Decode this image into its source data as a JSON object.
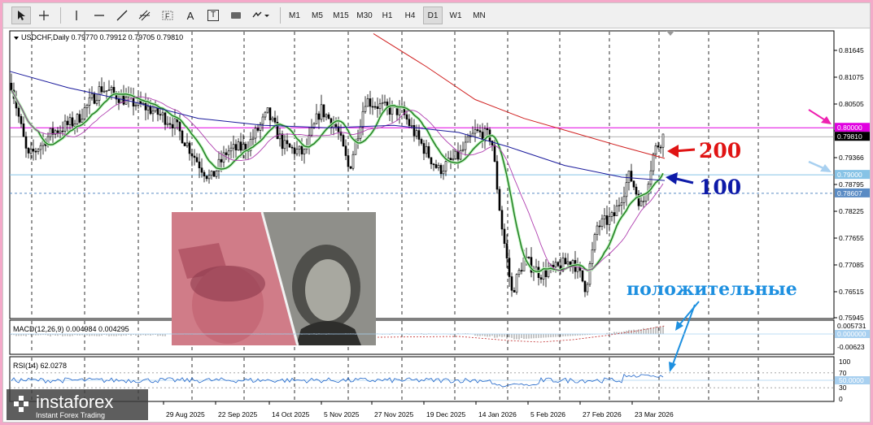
{
  "toolbar": {
    "tools": [
      "cursor-tool",
      "crosshair-tool",
      "vertical-line-tool",
      "horizontal-line-tool",
      "trend-line-tool",
      "channel-tool",
      "fibonacci-tool",
      "text-tool",
      "label-tool",
      "rectangle-tool",
      "arrows-tool"
    ],
    "text_tool_label": "A",
    "label_tool_label": "T",
    "fib_tool_label": "F",
    "timeframes": [
      "M1",
      "M5",
      "M15",
      "M30",
      "H1",
      "H4",
      "D1",
      "W1",
      "MN"
    ],
    "active_timeframe": "D1"
  },
  "chart": {
    "symbol_line": "USDCHF,Daily  0.79770 0.79912 0.79705 0.79810",
    "price_ticks": [
      "0.81645",
      "0.81075",
      "0.80505",
      "0.79936",
      "0.79366",
      "0.78795",
      "0.78225",
      "0.77655",
      "0.77085",
      "0.76515",
      "0.75945"
    ],
    "price_levels": {
      "magenta": {
        "label": "0.80000",
        "color": "#e000e0"
      },
      "current": {
        "label": "0.79810",
        "color": "#000000"
      },
      "light_blue": {
        "label": "0.79000",
        "color": "#87c3e6"
      },
      "steel_blue": {
        "label": "0.78607",
        "color": "#5a8bc4"
      }
    },
    "date_labels": [
      "29 Aug 2025",
      "22 Sep 2025",
      "14 Oct 2025",
      "5 Nov 2025",
      "27 Nov 2025",
      "19 Dec 2025",
      "14 Jan 2026",
      "5 Feb 2026",
      "27 Feb 2026",
      "23 Mar 2026"
    ],
    "annotations": {
      "ma200": {
        "text": "200",
        "color": "#e01414"
      },
      "ma100": {
        "text": "100",
        "color": "#0d1aa8"
      },
      "positive": {
        "text": "положительные",
        "color": "#1e90e0"
      }
    },
    "moving_average_colors": {
      "ma200": "#d02020",
      "ma100": "#1a1a9c",
      "ma_fast": "#1f7a1f",
      "ma_mid": "#b040b0"
    }
  },
  "macd": {
    "label": "MACD(12,26,9) 0.004984 0.004295",
    "ticks": [
      "0.005731",
      "0.000000",
      "-0.00623"
    ]
  },
  "rsi": {
    "label": "RSI(14) 62.0278",
    "ticks": [
      "100",
      "70",
      "50.0000",
      "30",
      "0"
    ]
  },
  "watermark": {
    "brand": "instaforex",
    "tagline": "Instant Forex Trading"
  }
}
